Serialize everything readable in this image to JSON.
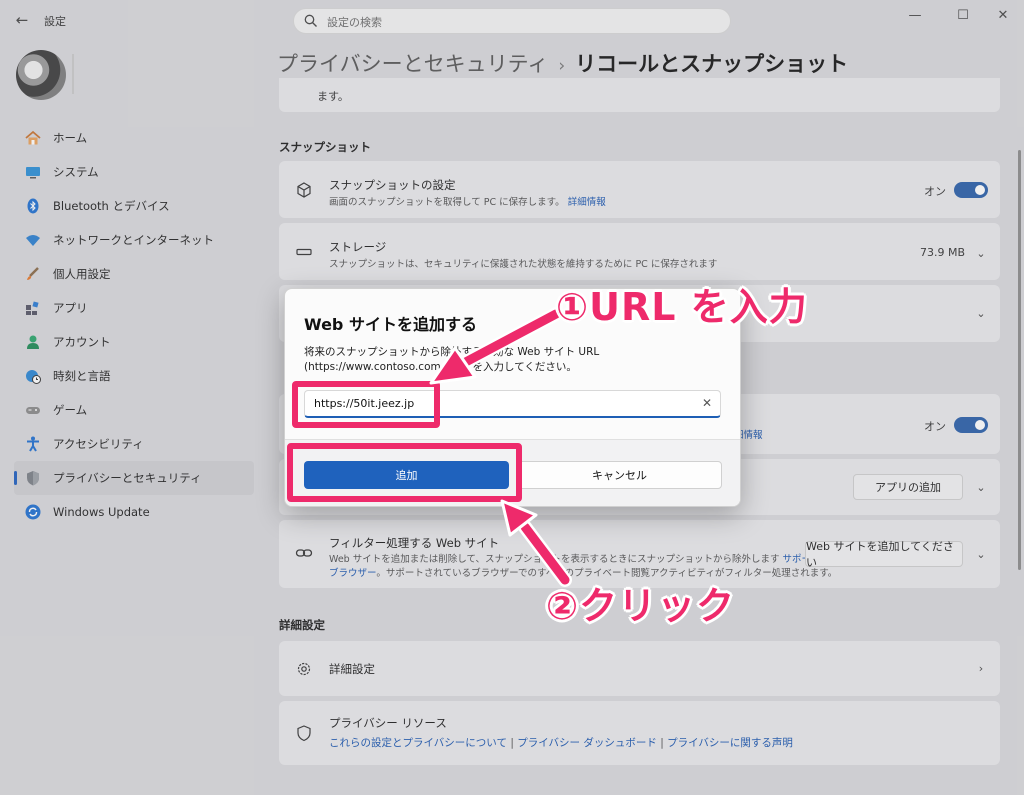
{
  "window": {
    "app_title": "設定",
    "search_placeholder": "設定の検索",
    "minimize": "—",
    "maximize": "☐",
    "close": "✕"
  },
  "sidebar": {
    "items": [
      {
        "label": "ホーム",
        "icon": "home-icon"
      },
      {
        "label": "システム",
        "icon": "system-icon"
      },
      {
        "label": "Bluetooth とデバイス",
        "icon": "bluetooth-icon"
      },
      {
        "label": "ネットワークとインターネット",
        "icon": "wifi-icon"
      },
      {
        "label": "個人用設定",
        "icon": "brush-icon"
      },
      {
        "label": "アプリ",
        "icon": "apps-icon"
      },
      {
        "label": "アカウント",
        "icon": "account-icon"
      },
      {
        "label": "時刻と言語",
        "icon": "globe-clock-icon"
      },
      {
        "label": "ゲーム",
        "icon": "gamepad-icon"
      },
      {
        "label": "アクセシビリティ",
        "icon": "accessibility-icon"
      },
      {
        "label": "プライバシーとセキュリティ",
        "icon": "shield-icon",
        "active": true
      },
      {
        "label": "Windows Update",
        "icon": "update-icon"
      }
    ]
  },
  "breadcrumb": {
    "parent": "プライバシーとセキュリティ",
    "separator": "›",
    "current": "リコールとスナップショット"
  },
  "main": {
    "cut_text": "ます。",
    "snapshots_header": "スナップショット",
    "snapshot_settings": {
      "title": "スナップショットの設定",
      "desc": "画面のスナップショットを取得して PC に保存します。",
      "link": "詳細情報",
      "state": "オン"
    },
    "storage": {
      "title": "ストレージ",
      "desc": "スナップショットは、セキュリティに保護された状態を維持するために PC に保存されます",
      "value": "73.9 MB"
    },
    "hidden_row": {
      "link": "細情報",
      "state": "オン"
    },
    "app_filter": {
      "button": "アプリの追加"
    },
    "web_filter": {
      "title": "フィルター処理する Web サイト",
      "desc_line1": "Web サイトを追加または削除して、スナップショットを表示するときにスナップショットから除外します",
      "link1": "サポートされている",
      "link2": "ブラウザー",
      "desc_line2": "。サポートされているブラウザーでのすべてのプライベート閲覧アクティビティがフィルター処理されます。",
      "button": "Web サイトを追加してください"
    },
    "advanced_header": "詳細設定",
    "advanced": {
      "title": "詳細設定"
    },
    "privacy_resources": {
      "title": "プライバシー リソース",
      "link1": "これらの設定とプライバシーについて",
      "link2": "プライバシー ダッシュボード",
      "link3": "プライバシーに関する声明",
      "divider": "|"
    }
  },
  "dialog": {
    "title": "Web サイトを追加する",
    "description": "将来のスナップショットから除外する有効な Web サイト URL (https://www.contoso.com など) を入力してください。",
    "url_value": "https://50it.jeez.jp",
    "add_button": "追加",
    "cancel_button": "キャンセル"
  },
  "annotations": {
    "step1": "①URL を入力",
    "step2": "②クリック",
    "color": "#ee2a6b"
  }
}
